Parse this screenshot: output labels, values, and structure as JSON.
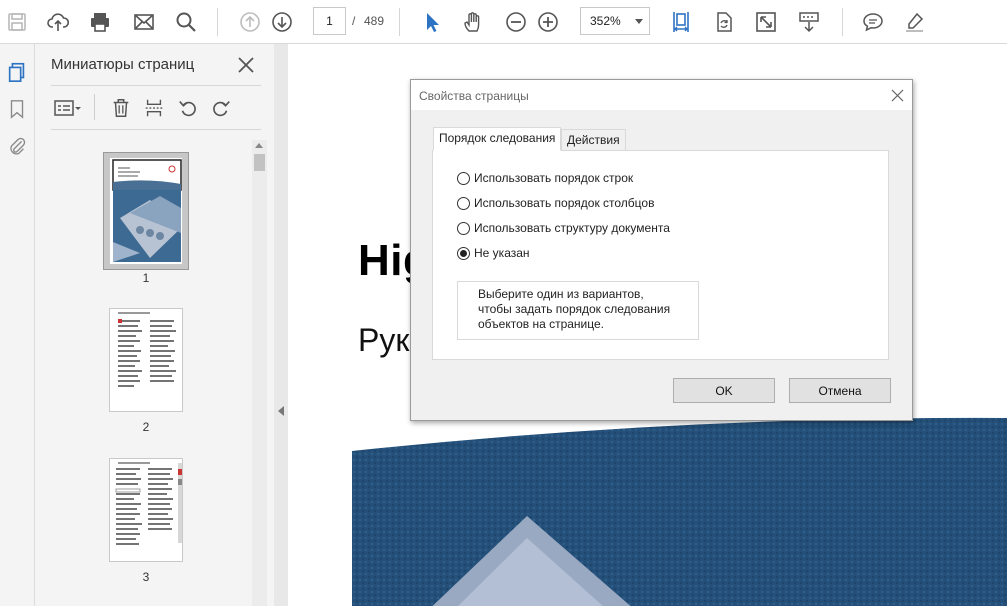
{
  "toolbar": {
    "page_current": "1",
    "page_separator": "/",
    "page_total": "489",
    "zoom_value": "352%",
    "accent_color": "#2d73c3",
    "icons": [
      "save-icon",
      "cloud-upload-icon",
      "print-icon",
      "email-icon",
      "search-icon",
      "previous-page-icon",
      "next-page-icon",
      "select-cursor-icon",
      "hand-icon",
      "zoom-out-icon",
      "zoom-in-icon",
      "fit-page-icon",
      "rotate-page-icon",
      "fullscreen-icon",
      "scroll-mode-icon",
      "comment-icon",
      "highlight-icon"
    ]
  },
  "rail": {
    "icons": [
      "page-thumbnails-icon",
      "bookmarks-icon",
      "attachments-icon"
    ]
  },
  "thumbnails": {
    "title": "Миниатюры страниц",
    "pages": [
      {
        "label": "1",
        "selected": true
      },
      {
        "label": "2",
        "selected": false
      },
      {
        "label": "3",
        "selected": false
      }
    ]
  },
  "document": {
    "heading_fragment": "Hig",
    "subheading_fragment": "Рук"
  },
  "dialog": {
    "title": "Свойства страницы",
    "tabs": [
      {
        "label": "Порядок следования",
        "active": true
      },
      {
        "label": "Действия",
        "active": false
      }
    ],
    "options": [
      {
        "label": "Использовать порядок строк",
        "checked": false
      },
      {
        "label": "Использовать порядок столбцов",
        "checked": false
      },
      {
        "label": "Использовать структуру документа",
        "checked": false
      },
      {
        "label": "Не указан",
        "checked": true
      }
    ],
    "help_text": "Выберите один из вариантов, чтобы задать порядок следования объектов на странице.",
    "ok_label": "OK",
    "cancel_label": "Отмена"
  }
}
